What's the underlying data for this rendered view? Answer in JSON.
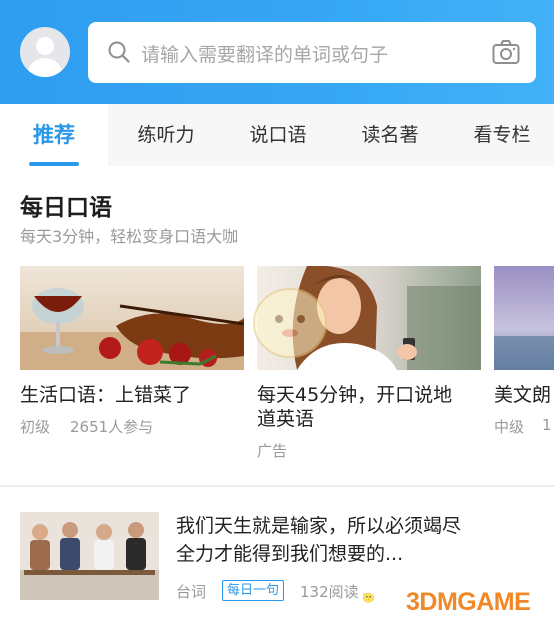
{
  "header": {
    "search_placeholder": "请输入需要翻译的单词或句子"
  },
  "tabs": [
    {
      "label": "推荐",
      "active": true
    },
    {
      "label": "练听力",
      "active": false
    },
    {
      "label": "说口语",
      "active": false
    },
    {
      "label": "读名著",
      "active": false
    },
    {
      "label": "看专栏",
      "active": false
    }
  ],
  "section": {
    "title": "每日口语",
    "subtitle": "每天3分钟，轻松变身口语大咖"
  },
  "cards": [
    {
      "title": "生活口语：上错菜了",
      "level": "初级",
      "participants": "2651人参与"
    },
    {
      "title_line1": "每天45分钟，开口说地",
      "title_line2": "道英语",
      "tag": "广告"
    },
    {
      "title": "美文朗",
      "level": "中级",
      "participants": "1"
    }
  ],
  "article": {
    "title_line1": "我们天生就是输家，所以必须竭尽",
    "title_line2": "全力才能得到我们想要的...",
    "category": "台词",
    "tag": "每日一句",
    "reads": "132阅读"
  },
  "watermark": {
    "text": "3DMGAME"
  },
  "colors": {
    "accent": "#2a98ea",
    "header_gradient_start": "#2f9df0",
    "header_gradient_end": "#41b2f7",
    "watermark_orange": "#f08828"
  }
}
